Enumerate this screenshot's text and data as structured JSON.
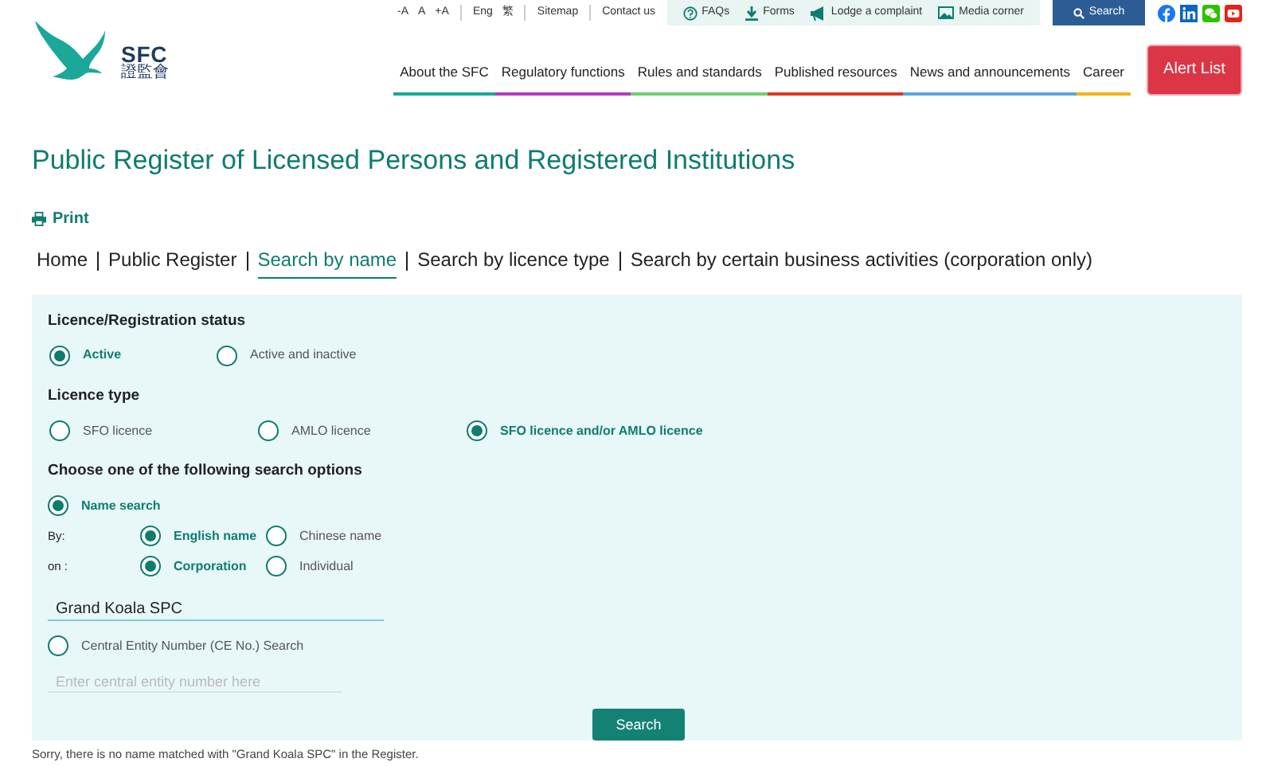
{
  "header": {
    "logo": {
      "abbr": "SFC",
      "chinese": "證監會"
    },
    "font_sizes": [
      "-A",
      "A",
      "+A"
    ],
    "languages": [
      "Eng",
      "繁"
    ],
    "top_links": [
      "Sitemap",
      "Contact us"
    ],
    "quick_links": [
      {
        "kind": "help",
        "label": "FAQs"
      },
      {
        "kind": "download",
        "label": "Forms"
      },
      {
        "kind": "megaphone",
        "label": "Lodge a complaint"
      },
      {
        "kind": "image",
        "label": "Media corner"
      }
    ],
    "search_button": "Search",
    "social": [
      {
        "kind": "facebook",
        "color": "#1877f2"
      },
      {
        "kind": "linkedin",
        "color": "#0a66c2"
      },
      {
        "kind": "wechat",
        "color": "#2dc100"
      },
      {
        "kind": "youtube",
        "color": "#e62117"
      }
    ],
    "nav": [
      {
        "label": "About the SFC",
        "color": "#1aa898"
      },
      {
        "label": "Regulatory functions",
        "color": "#b43bc0"
      },
      {
        "label": "Rules and standards",
        "color": "#6fcf6f"
      },
      {
        "label": "Published resources",
        "color": "#d9381e"
      },
      {
        "label": "News and announcements",
        "color": "#5aa6e0"
      },
      {
        "label": "Career",
        "color": "#f6b21b"
      }
    ],
    "alert_button": "Alert List"
  },
  "page_title": "Public Register of Licensed Persons and Registered Institutions",
  "print": "Print",
  "breadcrumb": [
    {
      "label": "Home",
      "selected": false
    },
    {
      "label": "Public Register",
      "selected": false
    },
    {
      "label": "Search by name",
      "selected": true
    },
    {
      "label": "Search by licence type",
      "selected": false
    },
    {
      "label": "Search by certain business activities (corporation only)",
      "selected": false
    }
  ],
  "form": {
    "status": {
      "heading": "Licence/Registration status",
      "options": [
        {
          "label": "Active",
          "selected": true
        },
        {
          "label": "Active and inactive",
          "selected": false
        }
      ]
    },
    "licence_type": {
      "heading": "Licence type",
      "options": [
        {
          "label": "SFO licence",
          "selected": false
        },
        {
          "label": "AMLO licence",
          "selected": false
        },
        {
          "label": "SFO licence and/or AMLO licence",
          "selected": true
        }
      ]
    },
    "search_options": {
      "heading": "Choose one of the following search options",
      "name_search": {
        "label": "Name search",
        "selected": true,
        "by": {
          "label": "By:",
          "options": [
            {
              "label": "English name",
              "selected": true
            },
            {
              "label": "Chinese name",
              "selected": false
            }
          ]
        },
        "on": {
          "label": "on :",
          "options": [
            {
              "label": "Corporation",
              "selected": true
            },
            {
              "label": "Individual",
              "selected": false
            }
          ]
        },
        "value": "Grand Koala SPC"
      },
      "ce_search": {
        "label": "Central Entity Number (CE No.) Search",
        "selected": false,
        "placeholder": "Enter central entity number here"
      }
    },
    "submit": "Search"
  },
  "message": "Sorry, there is no name matched with \"Grand Koala SPC\" in the Register."
}
